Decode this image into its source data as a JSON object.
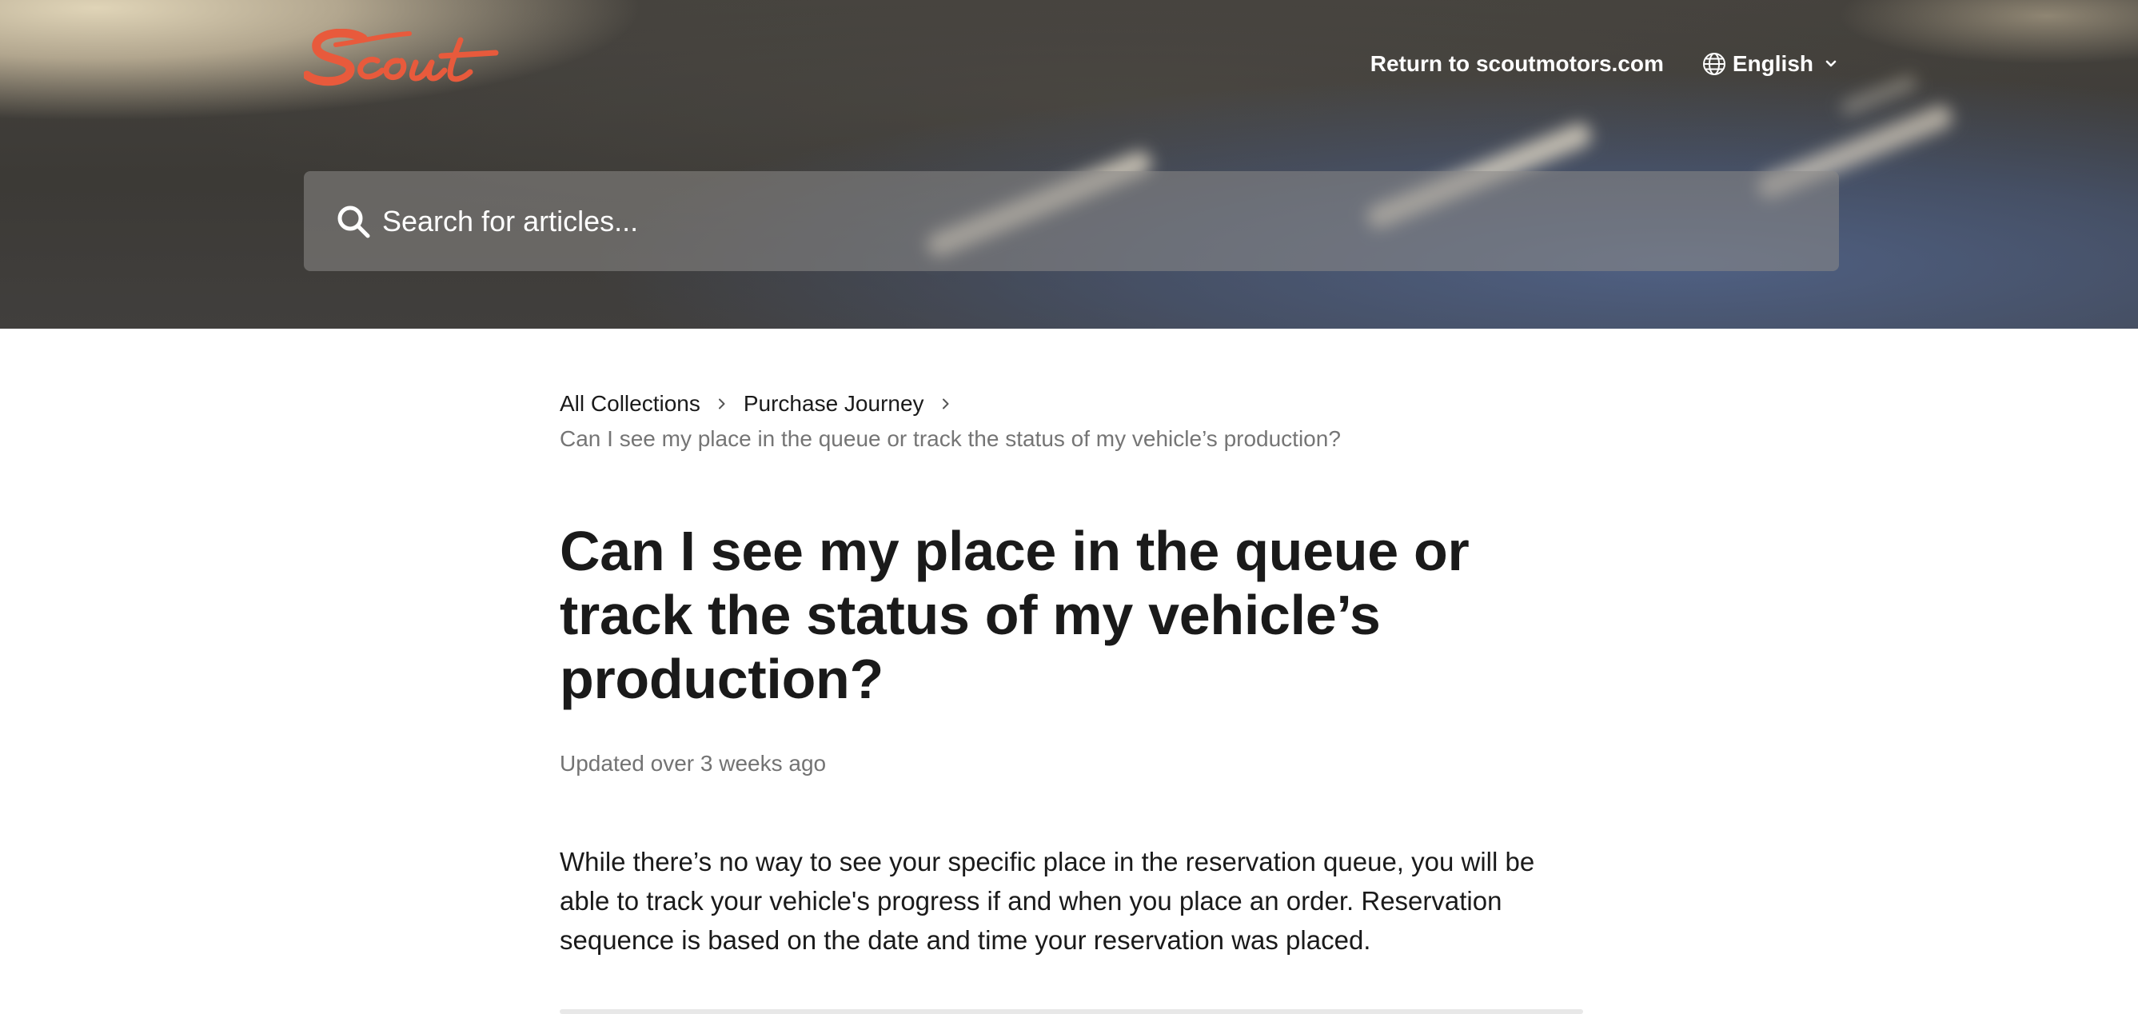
{
  "header": {
    "logo_alt": "Scout",
    "return_link": "Return to scoutmotors.com",
    "language": "English",
    "brand_color": "#e85a3c"
  },
  "search": {
    "placeholder": "Search for articles..."
  },
  "breadcrumb": {
    "items": [
      "All Collections",
      "Purchase Journey"
    ],
    "current": "Can I see my place in the queue or track the status of my vehicle’s production?"
  },
  "article": {
    "title": "Can I see my place in the queue or track the status of my vehicle’s production?",
    "updated": "Updated over 3 weeks ago",
    "body": "While there’s no way to see your specific place in the reservation queue, you will be able to track your vehicle's progress if and when you place an order. Reservation sequence is based on the date and time your reservation was placed."
  },
  "icons": {
    "search": "search-icon",
    "globe": "globe-icon",
    "chevron": "chevron-down-icon",
    "separator": "chevron-right-icon"
  }
}
